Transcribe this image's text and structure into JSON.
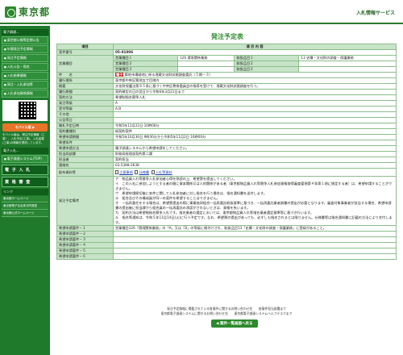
{
  "header": {
    "logo_text": "東京都",
    "service_title": "入札情報サービス"
  },
  "sidebar": {
    "head1": "電子調達...",
    "items": [
      "東京都公報等定期公告",
      "年間発注予定情報",
      "発注予定情報",
      "入札公告・指名",
      "入札結果情報",
      "発注・入札参加等",
      "入札参加資格情報"
    ],
    "mobile_btn": "モバイル版 ▶",
    "mobile_note": "モバイル版は、発注予定情報（工事）、入札予定(工事)、入札結果(工事)の情報を提供しています。",
    "head2": "電子入札...",
    "system_btn": "電子調達システム(TOP)",
    "e_bid": "電 子 入 札",
    "qualification": "資 格 審 査",
    "links_head": "リンク",
    "links": [
      "東京都ホームページ",
      "東京都電子自治体共同運営",
      "東京都公式ホームページ"
    ]
  },
  "page": {
    "title": "発注予定表",
    "col_item": "項目",
    "col_content": "項 目 内 容"
  },
  "detail": {
    "case_number_label": "案件番号",
    "case_number": "05-01006",
    "business_label": "営業種目",
    "business_items": [
      {
        "sub": "営業種目１",
        "value": "126 環境関係業務",
        "sub2": "取扱品目１",
        "value2": "13 史蹟・文化財の調査・保護業務"
      },
      {
        "sub": "営業種目２",
        "value": "",
        "sub2": "取扱品目２",
        "value2": ""
      },
      {
        "sub": "営業種目３",
        "value": "",
        "sub2": "取扱品目３",
        "value2": ""
      }
    ],
    "name_label": "件　　名",
    "name_tag": "電子",
    "name": "築地市場跡地に係る埋蔵文化財試掘調査委託（５期－３）",
    "location_label": "履行場所",
    "location": "東京都中央区築地五丁目地内",
    "overview_label": "概要",
    "overview": "文化財保護法第９５条に基づく中央区教育委員会の指導を受けて、埋蔵文化財試掘調査を行う。",
    "period_label": "履行期間",
    "period": "契約確定の日の翌日から令和6年3月21日まで",
    "contract_type_label": "契約方法",
    "contract_type": "希望制指名競争入札",
    "order_grade_label": "発注等級",
    "order_grade": "A",
    "accept_grade_label": "受付等級",
    "accept_grade": "A,B",
    "other_label": "その他",
    "bid_date_label": "公告等日",
    "bid_date": "",
    "open_date_label": "開札予定日時",
    "open_date": "令和5年11月22日 10時00分",
    "contract_form_label": "契約書種別",
    "contract_form": "紙契約案件",
    "apply_period_label": "希望申請期間",
    "apply_period": "令和5年10月30日 9時30分から令和5年11月2日 16時00分",
    "apply_condition_label": "希望条件",
    "apply_condition": "",
    "apply_method_label": "希望申請方法",
    "apply_method": "電子調達システムから希望申請をしてください。",
    "dept_label": "担当局部課",
    "dept": "財務局経理部契約第二課",
    "person_label": "担当者",
    "person": "契約担当",
    "contact_label": "連絡先",
    "contact": "03-5388-2638",
    "docs_label": "配布資料等",
    "docs": [
      "注意事項",
      "仕様書",
      "入札等資料"
    ],
    "notice_label": "発注予定備考",
    "notice": "ア　物品買入れ等競争入札参加者心得を熟読の上、希望票を提出してください。\nイ　この入札に参加しようとする者の間に資本関係又は人的関係がある者（東京都物品買入れ等競争入札参加資格取得審査要領第４条第１項に規定する者）は、希望申請することができません。\nウ　希望申請締切後に本件に関して入札参加者に対し指名を行う場合は、指名通知書を送付します。\nエ　組合及びその構成員が同一の案件を希望することはできません。\nオ　一括再委任をする場合は、希望票提出の際に事業協同組合一括再委託取扱基準に基づき、一括再委託業者調書の提出が必要となります。審査対象事業者が該当する場合、希望申請書の提出後に担当課から組合員の一括再委託の承認がされないときは、資格を失います。\nカ　契約方法は希望制指名競争入札です。指名業者の選定においては、東京都物品買入れ等指名業者選定基準等に基づき行います。\nキ　指名等通知は、令和５年11月14日(火)に行う予定です。なお、希望票の提出があっても、必ずしも指名されるとは限りません。仕様書等は指名通知書に記載の方法により交付します。",
    "applicant_label": "希望申請要件－１",
    "applicant1": "営業種目126「環境関係業務」の「A」又は「B」の等級に格付けされ、取扱品目13「史蹟・文化財の調査・保護業務」に登録があること。",
    "applicant_rest": [
      "希望申請要件－２",
      "希望申請要件－３",
      "希望申請要件－４",
      "希望申請要件－５",
      "希望申請要件－６"
    ]
  },
  "back_button": "◀ 案件一覧画面へ戻る",
  "footer": {
    "line1": "発注予定情報に掲載されている各案件に関するお問い合わせ先　　各案件担当部署まで",
    "line2": "東京都電子調達システムに関するお問い合わせ先　　東京都電子調達システムヘルプデスクまで"
  }
}
